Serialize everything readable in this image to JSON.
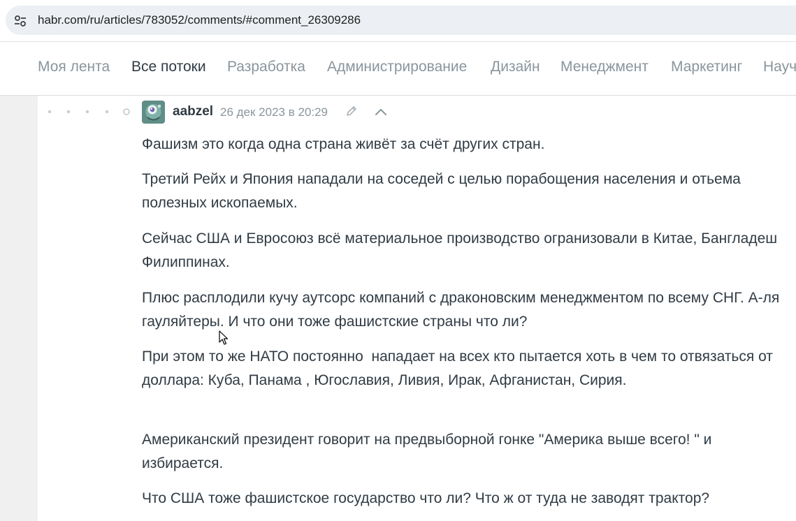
{
  "browser": {
    "url": "habr.com/ru/articles/783052/comments/#comment_26309286",
    "site_info_icon": "tune-icon"
  },
  "hubs_nav": {
    "items": [
      {
        "label": "Моя лента",
        "active": false
      },
      {
        "label": "Все потоки",
        "active": true
      },
      {
        "label": "Разработка",
        "active": false
      },
      {
        "label": "Администрирование",
        "active": false
      },
      {
        "label": "Дизайн",
        "active": false
      },
      {
        "label": "Менеджмент",
        "active": false
      },
      {
        "label": "Маркетинг",
        "active": false
      },
      {
        "label": "Научпоп",
        "active": false
      }
    ]
  },
  "comment": {
    "username": "aabzel",
    "date": "26 дек 2023 в 20:29",
    "paragraphs": [
      "Фашизм это когда одна страна живёт за счёт других стран.",
      "Третий Рейх и Япония нападали на соседей с целью порабощения населения и отьема полезных ископаемых.",
      "Сейчас США и Евросоюз всё материальное производство огранизовали в Китае, Бангладеш Филиппинах.",
      "Плюс расплодили кучу аутсорс компаний с драконовским менеджментом по всему СНГ. А-ля гауляйтеры. И что они тоже фашистские страны что ли?",
      "При этом то же НАТО постоянно  нападает на всех кто пытается хоть в чем то отвязаться от доллара: Куба, Панама , Югославия, Ливия, Ирак, Афганистан, Сирия.",
      "Американский президент говорит на предвыборной гонке \"Америка выше всего! \" и избирается.",
      "Что США тоже фашистское государство что ли? Что ж от туда не заводят трактор?"
    ]
  },
  "colors": {
    "text_primary": "#303b44",
    "text_muted": "#8a959d",
    "page_background": "#f0f0f0"
  }
}
